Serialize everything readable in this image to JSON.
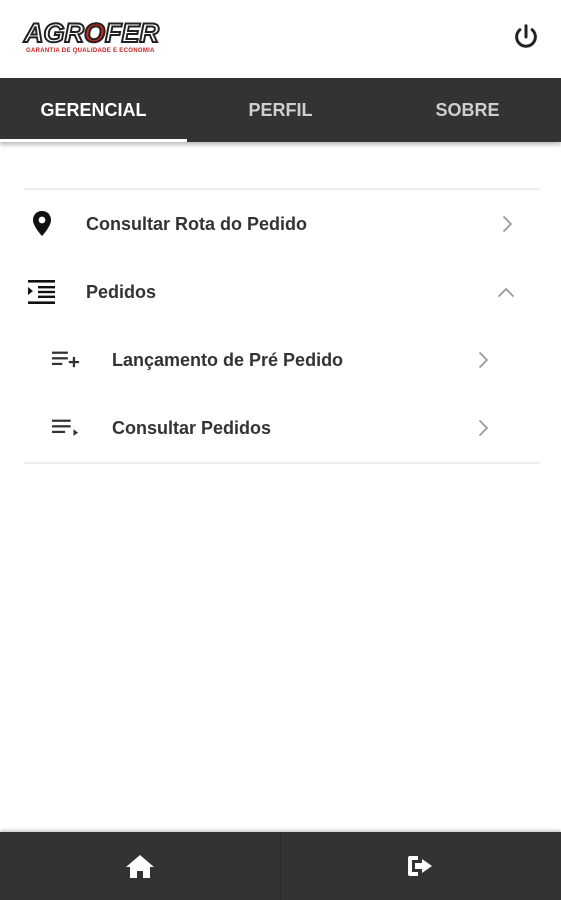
{
  "header": {
    "logo_text": "AGROFER",
    "logo_tagline": "GARANTIA DE QUALIDADE E ECONOMIA",
    "power_icon": "power-icon"
  },
  "tabs": [
    {
      "label": "GERENCIAL",
      "active": true
    },
    {
      "label": "PERFIL",
      "active": false
    },
    {
      "label": "SOBRE",
      "active": false
    }
  ],
  "menu": {
    "items": [
      {
        "label": "Consultar Rota do Pedido",
        "icon": "location-pin-icon"
      },
      {
        "label": "Pedidos",
        "icon": "indent-list-icon",
        "expanded": true
      },
      {
        "label": "Lançamento de Pré Pedido",
        "icon": "playlist-add-icon"
      },
      {
        "label": "Consultar Pedidos",
        "icon": "playlist-play-icon"
      }
    ]
  },
  "bottom_bar": {
    "home_icon": "home-icon",
    "exit_icon": "exit-icon"
  },
  "colors": {
    "bar_dark": "#333333",
    "brand_red": "#d8281f",
    "text_dark": "#333333",
    "tab_inactive": "#cfcfcf"
  }
}
